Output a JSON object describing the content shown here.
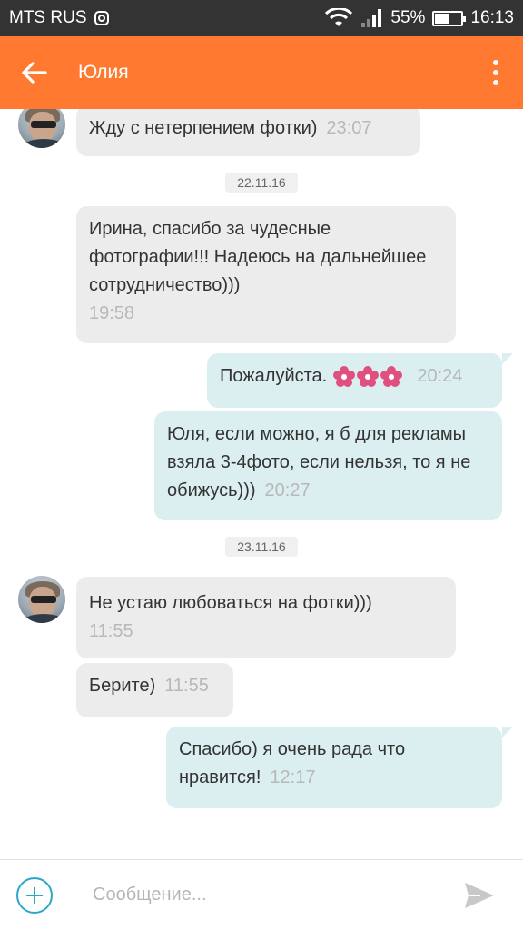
{
  "status_bar": {
    "carrier": "MTS RUS",
    "battery": "55%",
    "battery_level": 0.55,
    "time": "16:13"
  },
  "app_bar": {
    "title": "Юлия"
  },
  "messages": [
    {
      "text": "Жду с нетерпением фотки)",
      "time": "23:07"
    },
    {
      "text": "Ирина, спасибо за чудесные фотографии!!! Надеюсь на дальнейшее сотрудничество)))",
      "time": "19:58"
    },
    {
      "text": "Пожалуйста. ",
      "time": "20:24"
    },
    {
      "text": "Юля,  если можно,  я б для рекламы взяла 3-4фото, если нельзя,  то я не обижусь)))",
      "time": "20:27"
    },
    {
      "text": "Не устаю любоваться на фотки)))",
      "time": "11:55"
    },
    {
      "text": "Берите)",
      "time": "11:55"
    },
    {
      "text": "Спасибо) я очень рада что нравится!",
      "time": "12:17"
    }
  ],
  "dates": [
    "22.11.16",
    "23.11.16"
  ],
  "composer": {
    "placeholder": "Сообщение..."
  },
  "colors": {
    "app_bar": "#ff7a30",
    "incoming_bubble": "#ececec",
    "outgoing_bubble": "#dbeef0",
    "accent": "#2aa7c8"
  },
  "icons": {
    "back": "arrow-left-icon",
    "menu": "more-vertical-icon",
    "add": "plus-circle-icon",
    "send": "send-icon",
    "emoji": "flower-emoji"
  }
}
